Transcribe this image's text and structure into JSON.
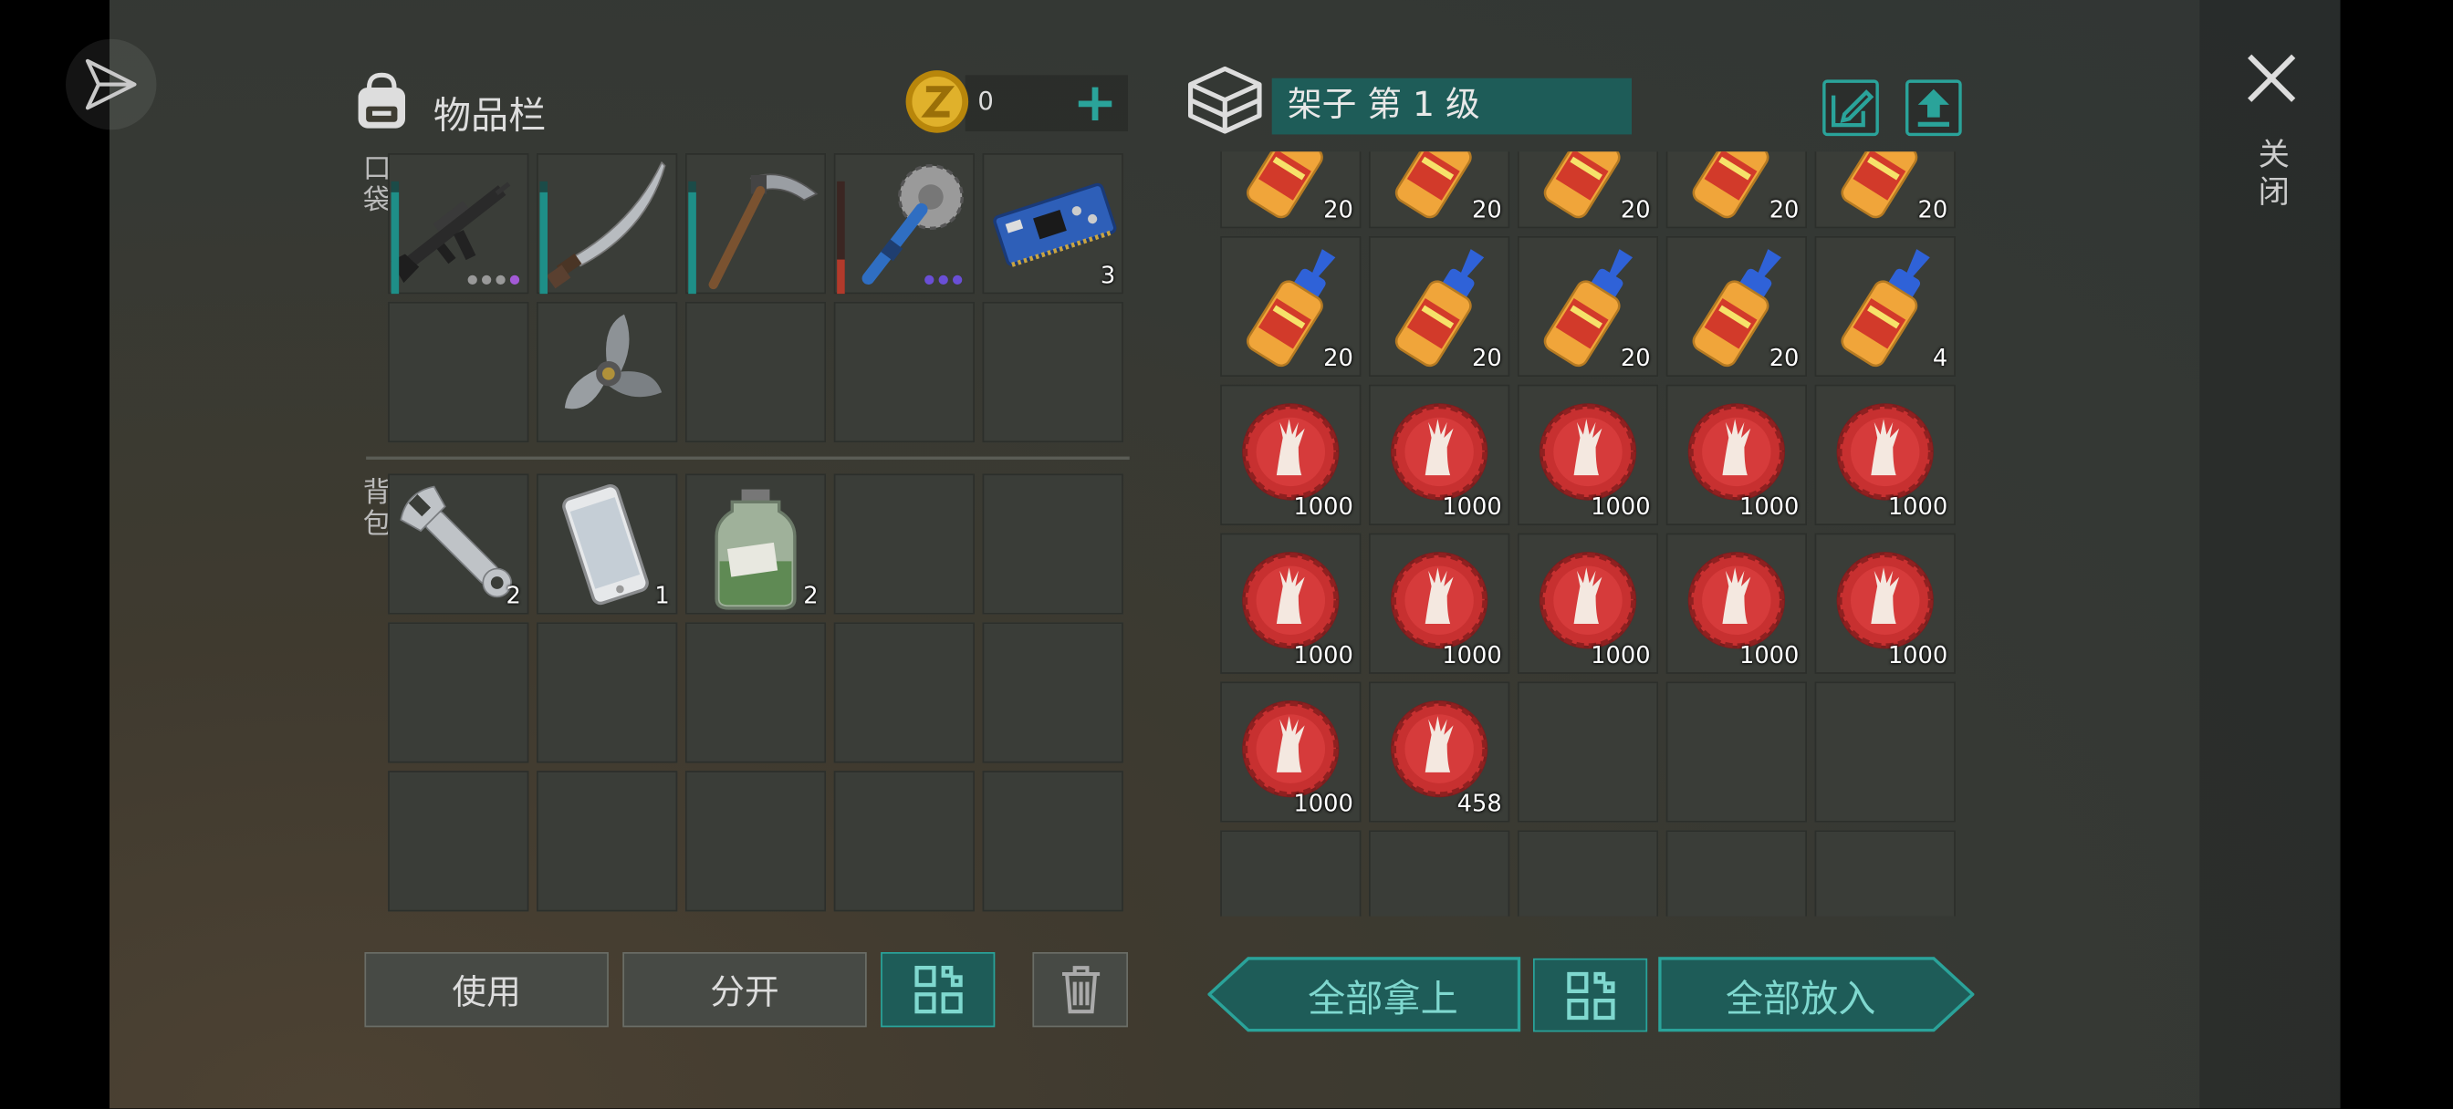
{
  "inventory": {
    "title": "物品栏",
    "coins": "0",
    "pockets_label": "口袋",
    "backpack_label": "背包",
    "pocket_slots": [
      {
        "item": "assault-rifle",
        "qty": "",
        "durability": 0.9,
        "dots": [
          "#999",
          "#999",
          "#999",
          "#a35ad6"
        ]
      },
      {
        "item": "machete",
        "qty": "",
        "durability": 0.9
      },
      {
        "item": "pickaxe",
        "qty": "",
        "durability": 0.9
      },
      {
        "item": "saw-mace",
        "qty": "",
        "durability": 0.3,
        "dots": [
          "#6a4fd6",
          "#6a4fd6",
          "#6a4fd6"
        ]
      },
      {
        "item": "circuit-board",
        "qty": "3"
      },
      {
        "item": "",
        "qty": ""
      },
      {
        "item": "propeller",
        "qty": ""
      },
      {
        "item": "",
        "qty": ""
      },
      {
        "item": "",
        "qty": ""
      },
      {
        "item": "",
        "qty": ""
      }
    ],
    "backpack_slots": [
      {
        "item": "wrench",
        "qty": "2"
      },
      {
        "item": "smartphone",
        "qty": "1"
      },
      {
        "item": "chemical-jar",
        "qty": "2"
      },
      {
        "item": "",
        "qty": ""
      },
      {
        "item": "",
        "qty": ""
      },
      {
        "item": "",
        "qty": ""
      },
      {
        "item": "",
        "qty": ""
      },
      {
        "item": "",
        "qty": ""
      },
      {
        "item": "",
        "qty": ""
      },
      {
        "item": "",
        "qty": ""
      },
      {
        "item": "",
        "qty": ""
      },
      {
        "item": "",
        "qty": ""
      },
      {
        "item": "",
        "qty": ""
      },
      {
        "item": "",
        "qty": ""
      },
      {
        "item": "",
        "qty": ""
      }
    ],
    "buttons": {
      "use": "使用",
      "split": "分开"
    }
  },
  "shelf": {
    "title": "架子 第 1 级",
    "slots": [
      {
        "item": "glue",
        "qty": "20"
      },
      {
        "item": "glue",
        "qty": "20"
      },
      {
        "item": "glue",
        "qty": "20"
      },
      {
        "item": "glue",
        "qty": "20"
      },
      {
        "item": "glue",
        "qty": "20"
      },
      {
        "item": "glue",
        "qty": "20"
      },
      {
        "item": "glue",
        "qty": "20"
      },
      {
        "item": "glue",
        "qty": "20"
      },
      {
        "item": "glue",
        "qty": "20"
      },
      {
        "item": "glue",
        "qty": "4"
      },
      {
        "item": "bottle-cap",
        "qty": "1000"
      },
      {
        "item": "bottle-cap",
        "qty": "1000"
      },
      {
        "item": "bottle-cap",
        "qty": "1000"
      },
      {
        "item": "bottle-cap",
        "qty": "1000"
      },
      {
        "item": "bottle-cap",
        "qty": "1000"
      },
      {
        "item": "bottle-cap",
        "qty": "1000"
      },
      {
        "item": "bottle-cap",
        "qty": "1000"
      },
      {
        "item": "bottle-cap",
        "qty": "1000"
      },
      {
        "item": "bottle-cap",
        "qty": "1000"
      },
      {
        "item": "bottle-cap",
        "qty": "1000"
      },
      {
        "item": "bottle-cap",
        "qty": "1000"
      },
      {
        "item": "bottle-cap",
        "qty": "458"
      },
      {
        "item": "",
        "qty": ""
      },
      {
        "item": "",
        "qty": ""
      },
      {
        "item": "",
        "qty": ""
      },
      {
        "item": "",
        "qty": ""
      },
      {
        "item": "",
        "qty": ""
      },
      {
        "item": "",
        "qty": ""
      },
      {
        "item": "",
        "qty": ""
      },
      {
        "item": "",
        "qty": ""
      }
    ],
    "buttons": {
      "take_all": "全部拿上",
      "put_all": "全部放入"
    }
  },
  "close_label": "关闭",
  "colors": {
    "accent": "#2aa39a",
    "slot": "#3a3d38"
  }
}
